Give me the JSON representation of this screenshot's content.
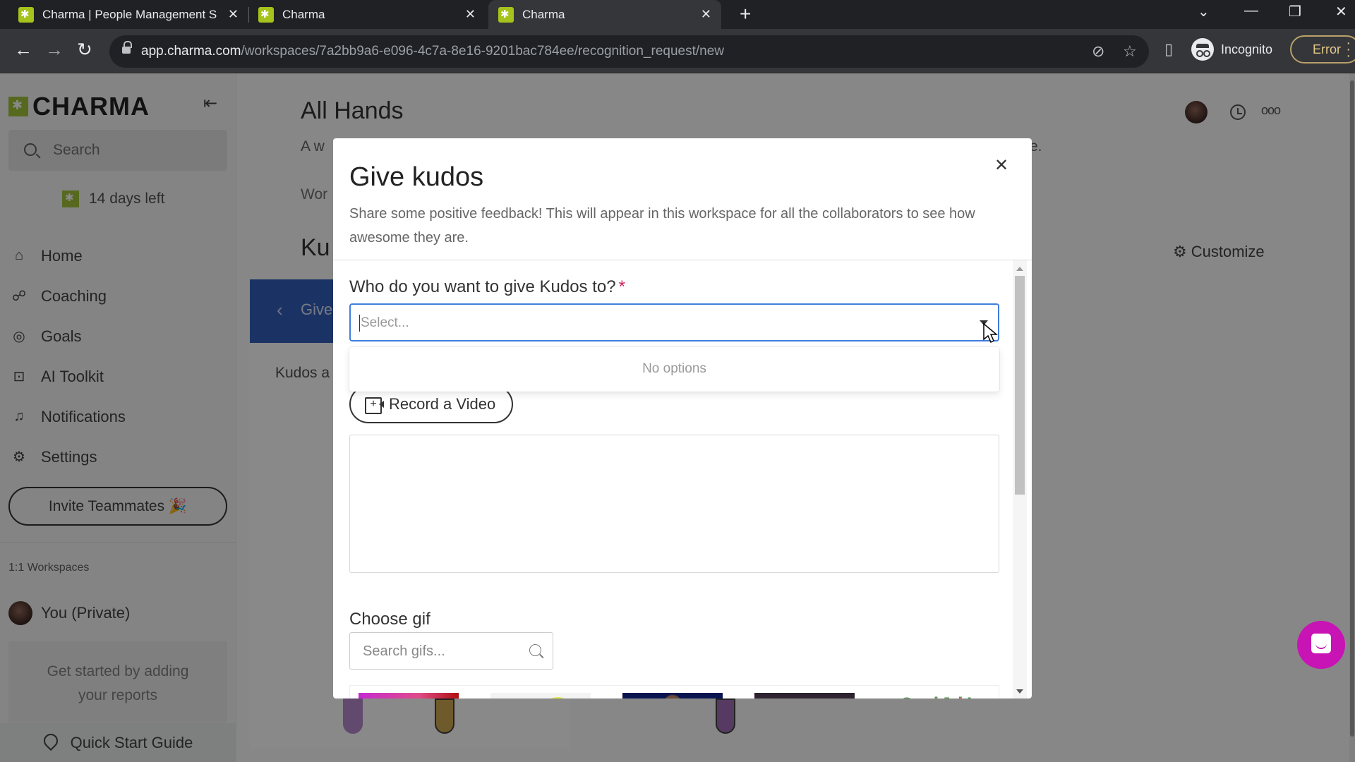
{
  "browser": {
    "tabs": [
      {
        "title": "Charma | People Management S",
        "active": false
      },
      {
        "title": "Charma",
        "active": false
      },
      {
        "title": "Charma",
        "active": true
      }
    ],
    "url_host": "app.charma.com",
    "url_path": "/workspaces/7a2bb9a6-e096-4c7a-8e16-9201bac784ee/recognition_request/new",
    "incognito_label": "Incognito",
    "error_label": "Error"
  },
  "sidebar": {
    "brand": "CHARMA",
    "search_placeholder": "Search",
    "trial_text": "14 days left",
    "nav": [
      {
        "label": "Home",
        "icon": "home-icon"
      },
      {
        "label": "Coaching",
        "icon": "coaching-icon"
      },
      {
        "label": "Goals",
        "icon": "goals-icon"
      },
      {
        "label": "AI Toolkit",
        "icon": "robot-icon"
      },
      {
        "label": "Notifications",
        "icon": "bell-icon"
      },
      {
        "label": "Settings",
        "icon": "gear-icon"
      }
    ],
    "invite_label": "Invite Teammates 🎉",
    "workspaces_heading": "1:1 Workspaces",
    "private_workspace": "You (Private)",
    "get_started": "Get started by adding your reports",
    "quick_start": "Quick Start Guide"
  },
  "page": {
    "title": "All Hands",
    "subtitle_start": "A w",
    "subtitle_end": "e.",
    "workspace_label": "Wor",
    "kudos_heading": "Ku",
    "customize_label": "Customize",
    "give_panel_label": "Give",
    "kudos_card_text": "Kudos a one"
  },
  "modal": {
    "title": "Give kudos",
    "description": "Share some positive feedback! This will appear in this workspace for all the collaborators to see how awesome they are.",
    "recipient_label": "Who do you want to give Kudos to?",
    "required_marker": "*",
    "select_placeholder": "Select...",
    "dropdown_empty": "No options",
    "record_video_label": "Record a Video",
    "message_value": "",
    "gif_label": "Choose gif",
    "gif_search_placeholder": "Search gifs...",
    "gif_thumbnails": [
      "gif-1",
      "gif-2",
      "gif-3",
      "gif-4",
      "Good Job!"
    ]
  },
  "colors": {
    "brand_green": "#9bbf2a",
    "select_focus": "#3f7ee0",
    "required": "#d0245a",
    "give_panel": "#2352b5",
    "chat_fab": "#c813b5"
  }
}
